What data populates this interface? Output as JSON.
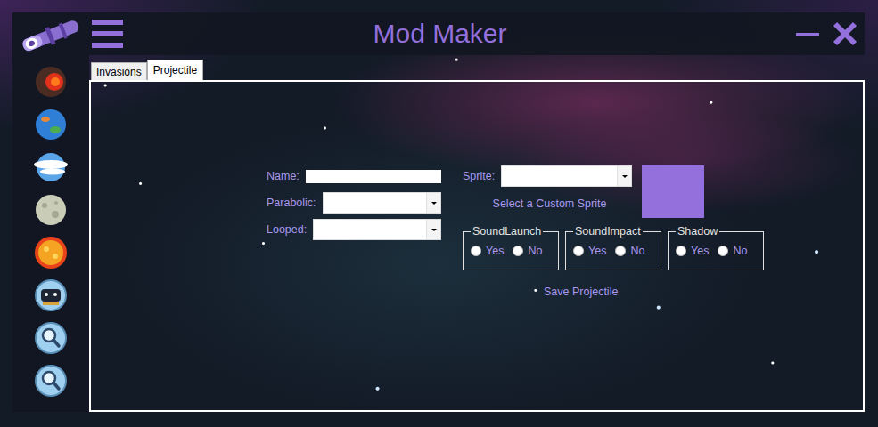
{
  "window": {
    "title": "Mod Maker"
  },
  "tabs": [
    {
      "label": "Invasions",
      "selected": false
    },
    {
      "label": "Projectile",
      "selected": true
    }
  ],
  "form": {
    "fields": [
      {
        "label": "Name:",
        "kind": "text"
      },
      {
        "label": "Parabolic:",
        "kind": "select"
      },
      {
        "label": "Looped:",
        "kind": "select"
      }
    ],
    "sprite": {
      "label": "Sprite:",
      "custom_link": "Select a Custom Sprite"
    },
    "options": [
      {
        "legend": "SoundLaunch",
        "choices": [
          {
            "label": "Yes",
            "selected": false
          },
          {
            "label": "No",
            "selected": false
          }
        ]
      },
      {
        "legend": "SoundImpact",
        "choices": [
          {
            "label": "Yes",
            "selected": false
          },
          {
            "label": "No",
            "selected": false
          }
        ]
      },
      {
        "legend": "Shadow",
        "choices": [
          {
            "label": "Yes",
            "selected": false
          },
          {
            "label": "No",
            "selected": false
          }
        ]
      }
    ],
    "save": "Save Projectile"
  }
}
